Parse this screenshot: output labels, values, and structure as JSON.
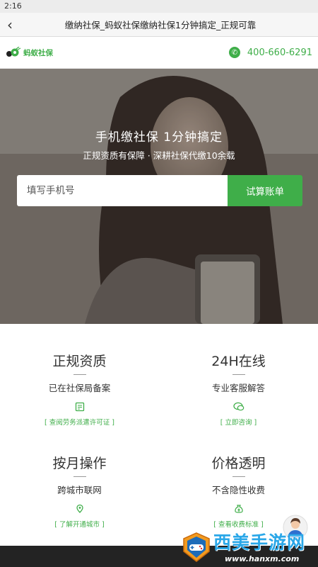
{
  "status_bar": {
    "time": "2:16"
  },
  "nav": {
    "title": "缴纳社保_蚂蚁社保缴纳社保1分钟搞定_正规可靠"
  },
  "header": {
    "logo_text": "蚂蚁社保",
    "phone": "400-660-6291"
  },
  "hero": {
    "title": "手机缴社保 1分钟搞定",
    "subtitle": "正规资质有保障 · 深耕社保代缴10余载",
    "input_placeholder": "填写手机号",
    "button_label": "试算账单"
  },
  "features": [
    {
      "title": "正规资质",
      "desc": "已在社保局备案",
      "link": "[ 查阅劳务派遣许可证 ]",
      "icon": "certificate-icon"
    },
    {
      "title": "24H在线",
      "desc": "专业客服解答",
      "link": "[ 立即咨询 ]",
      "icon": "chat-icon"
    },
    {
      "title": "按月操作",
      "desc": "跨城市联网",
      "link": "[ 了解开通城市 ]",
      "icon": "location-icon"
    },
    {
      "title": "价格透明",
      "desc": "不含隐性收费",
      "link": "[ 查看收费标准 ]",
      "icon": "money-bag-icon"
    }
  ],
  "watermark": {
    "text": "西美手游网",
    "url": "www.hanxm.com"
  },
  "colors": {
    "brand_green": "#3fae49",
    "bottom_bar": "#232323",
    "watermark_blue": "#2aa7e8"
  }
}
